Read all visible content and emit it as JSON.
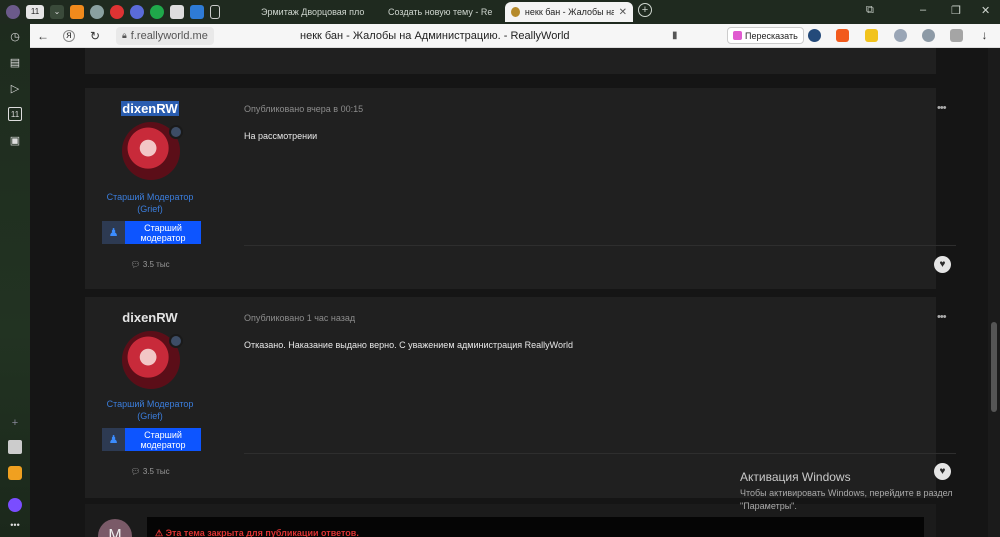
{
  "browser": {
    "tabs": [
      {
        "title": "Эрмитаж Дворцовая пло"
      },
      {
        "title": "Создать новую тему - Re"
      },
      {
        "title": "некк бан - Жалобы на А"
      }
    ],
    "tab_count": "11",
    "url": "f.reallyworld.me",
    "page_title": "некк бан - Жалобы на Администрацию. - ReallyWorld",
    "reader_label": "Пересказать",
    "sidebar_badge": "11"
  },
  "posts": [
    {
      "author": "dixenRW",
      "role_line1": "Старший Модератор",
      "role_line2": "(Grief)",
      "rank_line1": "Старший",
      "rank_line2": "модератор",
      "reputation": "3.5 тыс",
      "published": "Опубликовано вчера в 00:15",
      "body": "На рассмотрении",
      "menu": "•••"
    },
    {
      "author": "dixenRW",
      "role_line1": "Старший Модератор",
      "role_line2": "(Grief)",
      "rank_line1": "Старший",
      "rank_line2": "модератор",
      "reputation": "3.5 тыс",
      "published": "Опубликовано 1 час назад",
      "body": "Отказано. Наказание выдано верно. С уважением администрация ReallyWorld",
      "menu": "•••"
    }
  ],
  "reply": {
    "avatar_letter": "M",
    "locked_notice": "Эта тема закрыта для публикации ответов."
  },
  "watermark": {
    "title": "Активация Windows",
    "line1": "Чтобы активировать Windows, перейдите в раздел",
    "line2": "\"Параметры\"."
  },
  "colors": {
    "accent_blue": "#3b7ddb",
    "rank_blue": "#0d55ff",
    "locked_red": "#dd3333"
  }
}
